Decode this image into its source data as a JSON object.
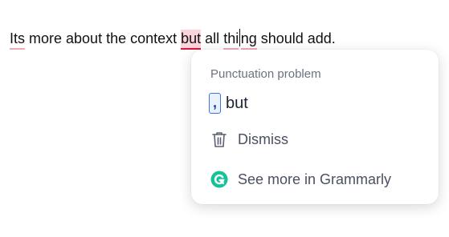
{
  "editor": {
    "segments": [
      {
        "text": "Its",
        "flag": "minor"
      },
      {
        "text": " more about the context ",
        "flag": "none"
      },
      {
        "text": "but",
        "flag": "active"
      },
      {
        "text": " all ",
        "flag": "none"
      },
      {
        "text": "thi",
        "flag": "minor"
      },
      {
        "text": "ng",
        "flag": "minor"
      },
      {
        "text": " should add.",
        "flag": "none"
      }
    ]
  },
  "card": {
    "category": "Punctuation problem",
    "suggestion": {
      "insert": ",",
      "word": "but"
    },
    "actions": {
      "dismiss": {
        "label": "Dismiss",
        "icon": "trash-icon"
      },
      "more": {
        "label": "See more in Grammarly",
        "icon": "grammarly-logo-icon"
      }
    }
  },
  "colors": {
    "active_underline": "#d7173b",
    "active_highlight": "#fbd4dc",
    "minor_underline": "#f1a9b8",
    "insert_border": "#3b73e0",
    "grammarly_green": "#15c39a"
  }
}
